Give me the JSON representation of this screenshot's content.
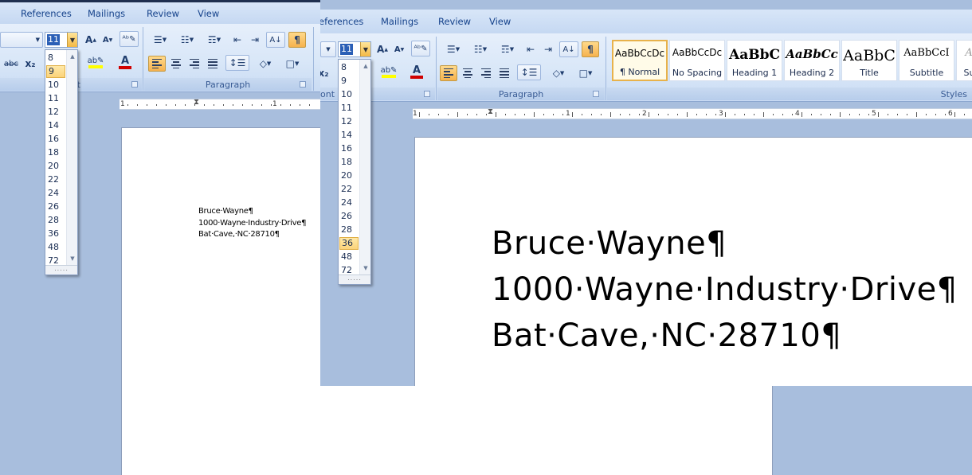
{
  "window1": {
    "tabs": [
      "References",
      "Mailings",
      "Review",
      "View"
    ],
    "font_size_value": "11",
    "group_labels": {
      "font": "Font",
      "paragraph": "Paragraph"
    },
    "strike_label": "abc",
    "subscript_label": "x₂",
    "dropdown": {
      "sizes": [
        "8",
        "9",
        "10",
        "11",
        "12",
        "14",
        "16",
        "18",
        "20",
        "22",
        "24",
        "26",
        "28",
        "36",
        "48",
        "72"
      ],
      "selected": "9"
    },
    "ruler_numbers": [
      "1",
      "1"
    ],
    "document_lines": [
      "Bruce·Wayne¶",
      "1000·Wayne·Industry·Drive¶",
      "Bat·Cave,·NC·28710¶"
    ]
  },
  "window2": {
    "tabs": [
      "eferences",
      "Mailings",
      "Review",
      "View"
    ],
    "font_size_value": "11",
    "group_labels": {
      "font": "ont",
      "paragraph": "Paragraph",
      "styles": "Styles"
    },
    "dropdown": {
      "sizes": [
        "8",
        "9",
        "10",
        "11",
        "12",
        "14",
        "16",
        "18",
        "20",
        "22",
        "24",
        "26",
        "28",
        "36",
        "48",
        "72"
      ],
      "selected": "36"
    },
    "ruler_numbers": [
      "1",
      "1",
      "2",
      "3",
      "4",
      "5",
      "6"
    ],
    "styles": [
      {
        "preview": "AaBbCcDc",
        "label": "¶ Normal"
      },
      {
        "preview": "AaBbCcDc",
        "label": "No Spacing"
      },
      {
        "preview": "AaBbC",
        "label": "Heading 1"
      },
      {
        "preview": "AaBbCc",
        "label": "Heading 2"
      },
      {
        "preview": "AaBbC",
        "label": "Title"
      },
      {
        "preview": "AaBbCcI",
        "label": "Subtitle"
      },
      {
        "preview": "Aa",
        "label": "Sub"
      }
    ],
    "document_lines": [
      "Bruce·Wayne¶",
      "1000·Wayne·Industry·Drive¶",
      "Bat·Cave,·NC·28710¶"
    ]
  },
  "colors": {
    "accent_highlight": "#f6b24e",
    "font_color_red": "#d00000",
    "highlight_yellow": "#ffff00",
    "selection_blue": "#2b5fb6"
  },
  "icons": [
    "bullets-icon",
    "numbering-icon",
    "multilevel-list-icon",
    "decrease-indent-icon",
    "increase-indent-icon",
    "sort-icon",
    "show-formatting-icon",
    "grow-font-icon",
    "shrink-font-icon",
    "clear-formatting-icon",
    "highlight-icon",
    "font-color-icon",
    "align-left-icon",
    "center-icon",
    "align-right-icon",
    "justify-icon",
    "line-spacing-icon",
    "shading-icon",
    "borders-icon"
  ]
}
